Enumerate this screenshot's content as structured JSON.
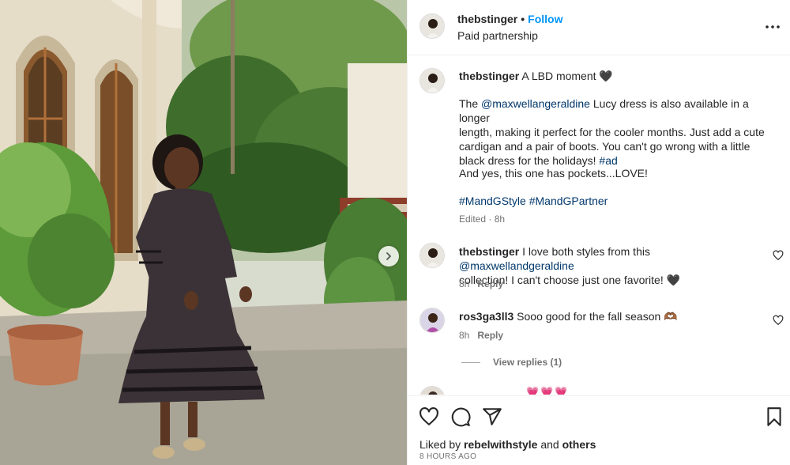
{
  "post_header": {
    "username": "thebstinger",
    "separator": "•",
    "follow_label": "Follow",
    "subtitle": "Paid partnership",
    "more_icon": "more-horizontal-icon"
  },
  "caption": {
    "username": "thebstinger",
    "text_head": "A LBD moment",
    "heart": "🖤",
    "para1_pre": "The",
    "para1_mention": "@maxwellangeraldine",
    "para1_l1": "Lucy dress is also available in a longer",
    "para1_l2": "length, making it perfect for the cooler months. Just add a cute",
    "para1_l3": "cardigan and a pair of boots. You can't go wrong with a little",
    "para1_l4": "black dress for the holidays!",
    "para1_tag": "#ad",
    "para2": "And yes, this one has pockets...LOVE!",
    "tag1": "#MandGStyle",
    "tag2": "#MandGPartner",
    "meta": "Edited · 8h"
  },
  "comments": [
    {
      "username": "thebstinger",
      "text_pre": "I love both styles from this",
      "mention": "@maxwellandgeraldine",
      "text_post": "collection! I can't choose just one favorite!",
      "emoji": "🖤",
      "time": "8h",
      "reply_label": "Reply"
    },
    {
      "username": "ros3ga3ll3",
      "text": "Sooo good for the fall season",
      "emoji": "🫶🏾",
      "time": "8h",
      "reply_label": "Reply",
      "view_replies": "View replies (1)"
    }
  ],
  "partial_comment": {
    "emoji": "💗💗💗"
  },
  "action_bar": {
    "icons": [
      "heart-icon",
      "comment-icon",
      "share-icon",
      "bookmark-icon"
    ]
  },
  "likes": {
    "prefix": "Liked by",
    "user": "rebelwithstyle",
    "conj": "and",
    "others": "others"
  },
  "timestamp": "8 HOURS AGO",
  "colors": {
    "follow_blue": "#0095f6",
    "link_dark_blue": "#00376b",
    "muted_gray": "#737373",
    "border": "#efefef"
  }
}
